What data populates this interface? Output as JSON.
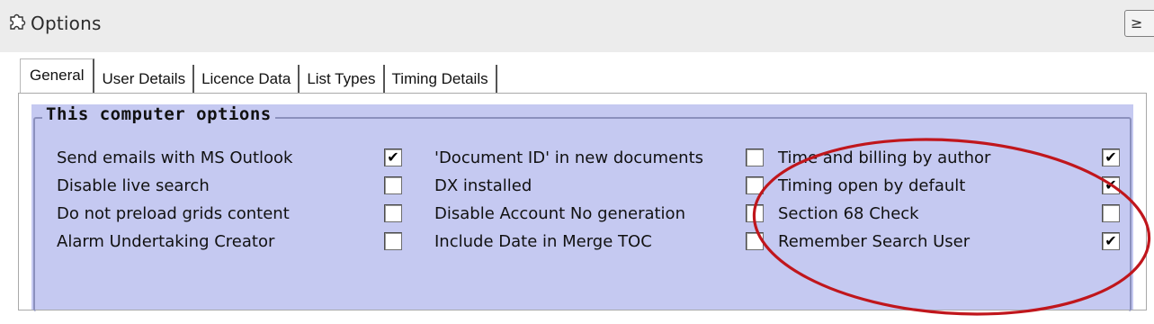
{
  "window": {
    "title": "Options",
    "corner_button": "≥",
    "icon": "puzzle-icon"
  },
  "tabs": [
    {
      "label": "General",
      "active": true
    },
    {
      "label": "User Details",
      "active": false
    },
    {
      "label": "Licence Data",
      "active": false
    },
    {
      "label": "List Types",
      "active": false
    },
    {
      "label": "Timing Details",
      "active": false
    }
  ],
  "group": {
    "title": "This computer options"
  },
  "columns": [
    [
      {
        "label": "Send emails with MS Outlook",
        "checked": true
      },
      {
        "label": "Disable live search",
        "checked": false
      },
      {
        "label": "Do not preload grids content",
        "checked": false
      },
      {
        "label": "Alarm Undertaking Creator",
        "checked": false
      }
    ],
    [
      {
        "label": "'Document ID' in new documents",
        "checked": false
      },
      {
        "label": "DX installed",
        "checked": false
      },
      {
        "label": "Disable Account No generation",
        "checked": false
      },
      {
        "label": "Include Date in Merge TOC",
        "checked": false
      }
    ],
    [
      {
        "label": "Time and billing by author",
        "checked": true
      },
      {
        "label": "Timing open by default",
        "checked": true
      },
      {
        "label": "Section 68 Check",
        "checked": false
      },
      {
        "label": "Remember Search User",
        "checked": true
      }
    ]
  ],
  "annotation": {
    "color": "#c0161c",
    "shape": "ellipse"
  },
  "colors": {
    "group_background": "#c5c9f1",
    "titlebar": "#ececec"
  },
  "check_glyph": "✔"
}
